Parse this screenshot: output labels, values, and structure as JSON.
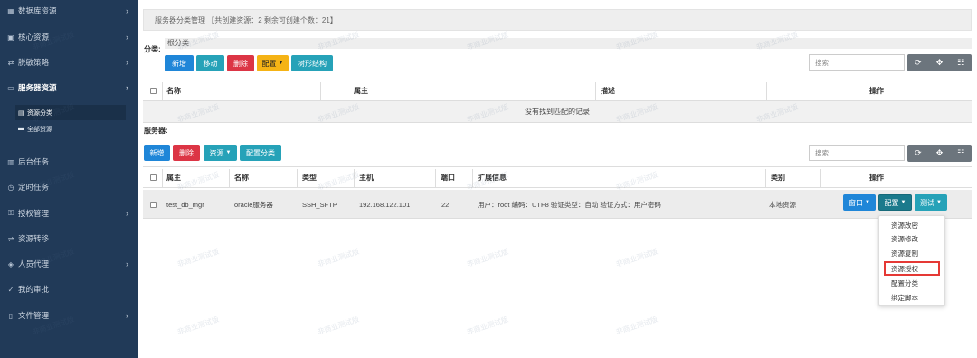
{
  "sidebar": {
    "items": [
      {
        "label": "数据库资源",
        "icon": "grid-icon"
      },
      {
        "label": "核心资源",
        "icon": "lock-icon"
      },
      {
        "label": "脱敏策略",
        "icon": "shuffle-icon"
      },
      {
        "label": "服务器资源",
        "icon": "monitor-icon"
      },
      {
        "label": "后台任务",
        "icon": "tasks-icon"
      },
      {
        "label": "定时任务",
        "icon": "clock-icon"
      },
      {
        "label": "授权管理",
        "icon": "key-icon"
      },
      {
        "label": "资源转移",
        "icon": "transfer-icon"
      },
      {
        "label": "人员代理",
        "icon": "agent-icon"
      },
      {
        "label": "我的审批",
        "icon": "approve-icon"
      },
      {
        "label": "文件管理",
        "icon": "file-icon"
      }
    ],
    "sub_items": [
      {
        "label": "资源分类",
        "icon": "list-icon"
      },
      {
        "label": "全部资源",
        "icon": "box-icon"
      }
    ]
  },
  "breadcrumb": "服务器分类管理 【共创建资源：2   剩余可创建个数：21】",
  "category": {
    "label": "分类:",
    "root_label": "根分类",
    "buttons": {
      "add": "新增",
      "move": "移动",
      "delete": "删除",
      "config": "配置",
      "tree": "树形结构"
    },
    "search_placeholder": "搜索",
    "columns": [
      "名称",
      "属主",
      "描述",
      "操作"
    ],
    "empty_text": "没有找到匹配的记录"
  },
  "server": {
    "label": "服务器:",
    "buttons": {
      "add": "新增",
      "delete": "删除",
      "resource": "资源",
      "config_category": "配置分类"
    },
    "search_placeholder": "搜索",
    "columns": [
      "属主",
      "名称",
      "类型",
      "主机",
      "端口",
      "扩展信息",
      "类别",
      "操作"
    ],
    "rows": [
      {
        "owner": "test_db_mgr",
        "name": "oracle服务器",
        "type": "SSH_SFTP",
        "host": "192.168.122.101",
        "port": "22",
        "ext": "用户：root  编码：UTF8  验证类型：自动  验证方式：用户密码",
        "category": "本地资源",
        "actions": {
          "window": "窗口",
          "config": "配置",
          "test": "测试"
        }
      }
    ]
  },
  "dropdown": {
    "items": [
      "资源改密",
      "资源修改",
      "资源复制",
      "资源授权",
      "配置分类",
      "绑定脚本"
    ],
    "highlighted": "资源授权"
  },
  "toolbar_icons": [
    "refresh-icon",
    "move-icon",
    "columns-icon"
  ],
  "watermark": "非商业测试版",
  "colors": {
    "sidebar": "#213a58",
    "primary": "#1f86d8",
    "info": "#26a2b8",
    "danger": "#dc3545",
    "warning": "#f5b315",
    "highlight": "#e53935"
  }
}
